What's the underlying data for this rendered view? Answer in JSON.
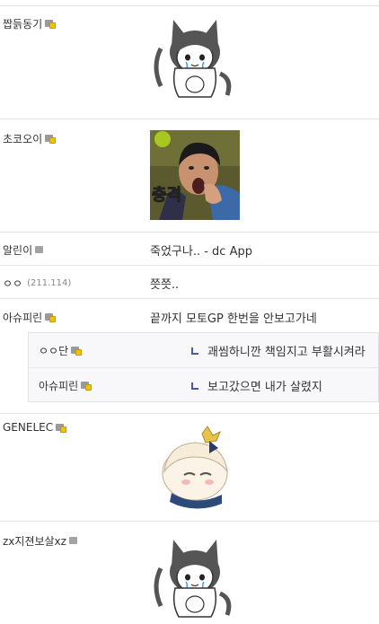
{
  "comments": [
    {
      "nick": "짭듥동기",
      "badge": "gold",
      "type": "image",
      "image": "cat-girl-sticker"
    },
    {
      "nick": "초코오이",
      "badge": "gold",
      "type": "image",
      "image": "shocked-man-photo",
      "caption": "충격"
    },
    {
      "nick": "알린이",
      "badge": "gray",
      "type": "text",
      "text": "죽었구나.. - dc App"
    },
    {
      "nick": "ㅇㅇ",
      "ip": "(211.114)",
      "type": "text",
      "text": "쯧쯧.."
    },
    {
      "nick": "아슈피린",
      "badge": "gold",
      "type": "text",
      "text": "끝까지 모토GP 한번을 안보고가네"
    },
    {
      "nick": "GENELEC",
      "badge": "gold",
      "type": "image",
      "image": "white-hair-girl-sticker"
    },
    {
      "nick": "zx지젼보살xz",
      "badge": "gray",
      "type": "image",
      "image": "cat-girl-sticker"
    }
  ],
  "replies": [
    {
      "nick": "ㅇㅇ단",
      "badge": "gold",
      "text": "괘씸하니깐 책임지고 부활시켜라"
    },
    {
      "nick": "아슈피린",
      "badge": "gold",
      "text": "보고갔으면 내가 살렸지"
    }
  ]
}
